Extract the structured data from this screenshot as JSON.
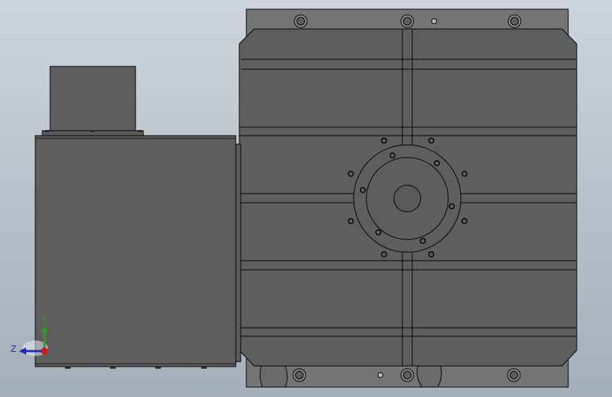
{
  "viewport": {
    "background_top": "#cdd4dc",
    "background_bottom": "#a4afbb"
  },
  "colors": {
    "body": "#5e5e5e",
    "body_dark": "#555555",
    "plate": "#727272",
    "edge": "#000000",
    "axis_y": "#2e9c2e",
    "axis_z": "#1d2bb8",
    "axis_x": "#d11a1a"
  },
  "triad": {
    "y_label": "Y",
    "z_label": "Z",
    "icon": "coordinate-triad-icon"
  }
}
